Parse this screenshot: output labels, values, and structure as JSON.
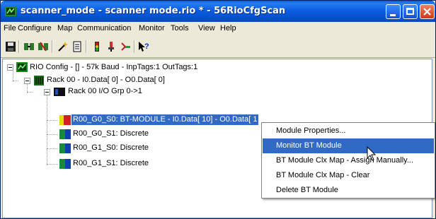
{
  "window": {
    "title": "scanner_mode - scanner mode.rio * - 56RioCfgScan"
  },
  "menubar": [
    "File",
    "Configure",
    "Map",
    "Communication",
    "Monitor",
    "Tools",
    "View",
    "Help"
  ],
  "toolbar": {
    "icons": [
      "save-icon",
      "connect-icon",
      "disconnect-icon",
      "wizard-icon",
      "document-icon",
      "signal-icon",
      "probe-icon",
      "tool-icon",
      "help-icon"
    ]
  },
  "tree": {
    "root": "RIO Config - [] -  57k Baud - InpTags:1 OutTags:1",
    "rack": "Rack 00 - I0.Data[ 0] - O0.Data[ 0]",
    "group": "Rack 00 I/O Grp 0->1",
    "items": [
      "R00_G0_S0: BT-MODULE - I0.Data[ 10] - O0.Data[ 1",
      "R00_G0_S1: Discrete",
      "R00_G1_S0: Discrete",
      "R00_G1_S1: Discrete"
    ]
  },
  "context_menu": {
    "items": [
      "Module Properties...",
      "Monitor BT Module",
      "BT Module Clx Map - Assign Manually...",
      "BT Module Clx Map - Clear",
      "Delete BT Module"
    ],
    "highlighted_index": 1
  },
  "colors": {
    "titlebar": "#0a5bd8",
    "selection": "#316ac5",
    "window_bg": "#ece9d8"
  }
}
